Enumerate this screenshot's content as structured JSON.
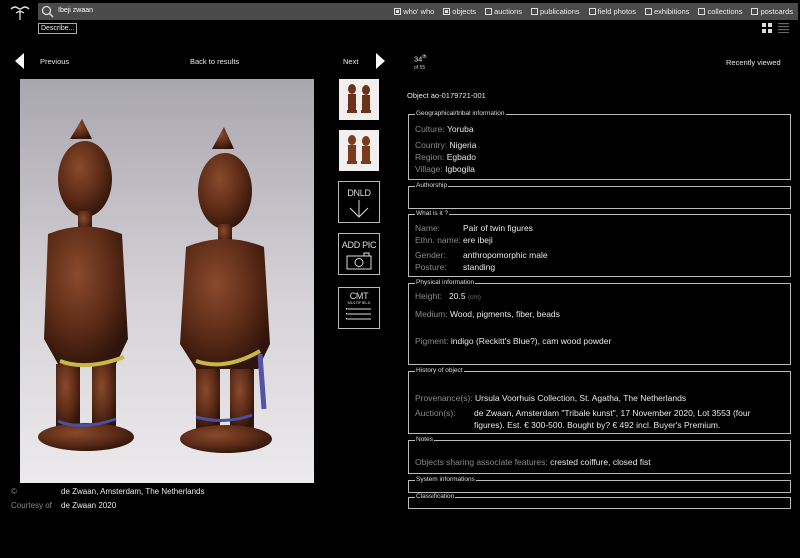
{
  "search": {
    "query": "Ibeji zwaan"
  },
  "filters": [
    {
      "label": "who' who",
      "checked": true
    },
    {
      "label": "objects",
      "checked": true
    },
    {
      "label": "auctions",
      "checked": false
    },
    {
      "label": "publications",
      "checked": false
    },
    {
      "label": "field photos",
      "checked": false
    },
    {
      "label": "exhibitions",
      "checked": false
    },
    {
      "label": "collections",
      "checked": false
    },
    {
      "label": "postcards",
      "checked": false
    }
  ],
  "describe_label": "Describe...",
  "nav": {
    "previous": "Previous",
    "back": "Back to results",
    "next": "Next",
    "rank": "34",
    "rank_suffix": "th",
    "rank_of": "of 55",
    "recently_viewed": "Recently viewed"
  },
  "object_id": "Object ao-0179721-001",
  "credit": {
    "copyright_key": "©",
    "copyright_value": "de Zwaan, Amsterdam, The Netherlands",
    "courtesy_key": "Courtesy of",
    "courtesy_value": "de Zwaan 2020"
  },
  "tools": {
    "download": "DNLD",
    "add_pic": "ADD PIC",
    "comment": "CMT",
    "comment_sub": "MULTIFIELD"
  },
  "sections": {
    "geo": {
      "legend": "Geographical/tribal information",
      "culture_k": "Culture:",
      "culture_v": "Yoruba",
      "country_k": "Country:",
      "country_v": "Nigeria",
      "region_k": "Region:",
      "region_v": "Egbado",
      "village_k": "Village:",
      "village_v": "Igbogila"
    },
    "authorship": {
      "legend": "Authorship"
    },
    "what": {
      "legend": "What is it ?",
      "name_k": "Name:",
      "name_v": "Pair of twin figures",
      "ethn_k": "Ethn. name:",
      "ethn_v": "ere ibeji",
      "gender_k": "Gender:",
      "gender_v": "anthropomorphic male",
      "posture_k": "Posture:",
      "posture_v": "standing"
    },
    "physical": {
      "legend": "Physical information",
      "height_k": "Height:",
      "height_v": "20.5",
      "height_unit": "(cm)",
      "medium_k": "Medium:",
      "medium_v": "Wood, pigments, fiber, beads",
      "pigment_k": "Pigment:",
      "pigment_v": "indigo (Reckitt's Blue?), cam wood powder"
    },
    "history": {
      "legend": "History of object",
      "prov_k": "Provenance(s):",
      "prov_v": "Ursula Voorhuis Collection, St. Agatha, The Netherlands",
      "auction_k": "Auction(s):",
      "auction_v1": "de Zwaan, Amsterdam \"Tribale kunst\", 17 November 2020, Lot 3553 (four",
      "auction_v2": "figures). Est. € 300-500. Bought by? € 492 incl. Buyer's Premium."
    },
    "notes": {
      "legend": "Notes",
      "features_k": "Objects sharing associate features:",
      "features_v": "crested coiffure, closed fist"
    },
    "system": {
      "legend": "System informations"
    },
    "classification": {
      "legend": "Classification"
    }
  },
  "colors": {
    "background": "#000000",
    "searchbar": "#4a4a4a",
    "label": "#8a8a8a"
  }
}
